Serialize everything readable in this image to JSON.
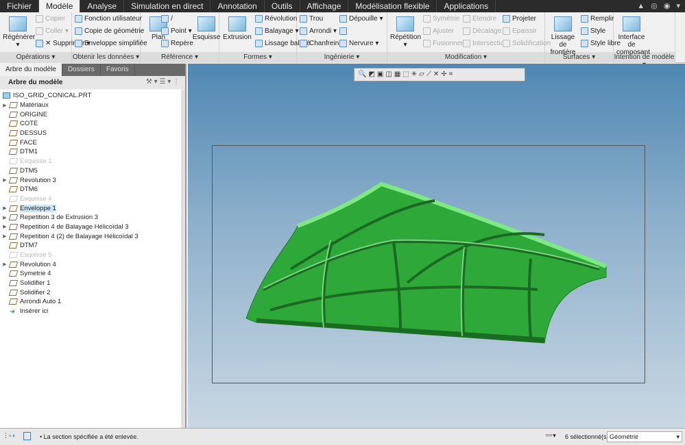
{
  "tabs": [
    "Fichier",
    "Modèle",
    "Analyse",
    "Simulation en direct",
    "Annotation",
    "Outils",
    "Affichage",
    "Modélisation flexible",
    "Applications"
  ],
  "active_tab": "Modèle",
  "groups": [
    {
      "label": "Opérations ▾",
      "items": [
        {
          "t": "Copier",
          "d": true
        },
        {
          "t": "Coller ▾",
          "d": true
        },
        {
          "t": "✕ Supprimer ▾"
        }
      ],
      "big": [
        "Régénérer ▾"
      ]
    },
    {
      "label": "Obtenir les données ▾",
      "items": [
        {
          "t": "Fonction utilisateur"
        },
        {
          "t": "Copie de géométrie"
        },
        {
          "t": "Enveloppe simplifiée"
        }
      ],
      "big": []
    },
    {
      "label": "Référence ▾",
      "items": [
        {
          "t": "/"
        },
        {
          "t": "Point ▾"
        },
        {
          "t": "Repère"
        }
      ],
      "big": [
        "Plan",
        "Esquisse"
      ]
    },
    {
      "label": "Formes ▾",
      "items": [
        {
          "t": "Révolution"
        },
        {
          "t": "Balayage ▾"
        },
        {
          "t": "Lissage balayé"
        }
      ],
      "big": [
        "Extrusion"
      ]
    },
    {
      "label": "Ingénierie ▾",
      "items": [
        {
          "t": "Trou"
        },
        {
          "t": "Arrondi ▾"
        },
        {
          "t": "Chanfrein ▾"
        },
        {
          "t": "Dépouille ▾"
        },
        {
          "t": ""
        },
        {
          "t": "Nervure ▾"
        }
      ],
      "big": []
    },
    {
      "label": "Modification ▾",
      "items": [
        {
          "t": "Symétrie",
          "d": true
        },
        {
          "t": "Ajuster",
          "d": true
        },
        {
          "t": "Fusionner",
          "d": true
        },
        {
          "t": "Etendre",
          "d": true
        },
        {
          "t": "Décalage",
          "d": true
        },
        {
          "t": "Intersection",
          "d": true
        },
        {
          "t": "Projeter"
        },
        {
          "t": "Epaissir",
          "d": true
        },
        {
          "t": "Solidification",
          "d": true
        }
      ],
      "big": [
        "Répétition ▾"
      ]
    },
    {
      "label": "Surfaces ▾",
      "items": [
        {
          "t": "Remplir"
        },
        {
          "t": "Style"
        },
        {
          "t": "Style libre"
        }
      ],
      "big": [
        "Lissage de frontière"
      ]
    },
    {
      "label": "Intention de modèle ▾",
      "items": [],
      "big": [
        "Interface de composant"
      ]
    }
  ],
  "left_tabs": [
    "Arbre du modèle",
    "Dossiers",
    "Favoris"
  ],
  "tree_header": "Arbre du modèle",
  "tree": [
    {
      "t": "ISO_GRID_CONICAL.PRT",
      "root": true
    },
    {
      "t": "Matériaux",
      "exp": true
    },
    {
      "t": "ORIGINE"
    },
    {
      "t": "COTE"
    },
    {
      "t": "DESSUS"
    },
    {
      "t": "FACE"
    },
    {
      "t": "DTM1"
    },
    {
      "t": "Esquisse 1",
      "dim": true
    },
    {
      "t": "DTM5"
    },
    {
      "t": "Revolution 3",
      "exp": true
    },
    {
      "t": "DTM6"
    },
    {
      "t": "Esquisse 4",
      "dim": true
    },
    {
      "t": "Enveloppe 1",
      "exp": true,
      "sel": true
    },
    {
      "t": "Repetition 3 de Extrusion 3",
      "exp": true
    },
    {
      "t": "Repetition 4 de Balayage Hélicoïdal 3",
      "exp": true
    },
    {
      "t": "Repetition 4 (2) de Balayage Hélicoïdal 3",
      "exp": true
    },
    {
      "t": "DTM7"
    },
    {
      "t": "Esquisse 5",
      "dim": true
    },
    {
      "t": "Revolution 4",
      "exp": true
    },
    {
      "t": "Symetrie 4"
    },
    {
      "t": "Solidifier 1"
    },
    {
      "t": "Solidifier 2"
    },
    {
      "t": "Arrondi Auto 1"
    },
    {
      "t": "Insérer ici",
      "insert": true
    }
  ],
  "status": {
    "message": "• La section spécifiée a été enlevée.",
    "selected": "6 sélectionné(s)",
    "filter": "Géométrie"
  },
  "colors": {
    "model": "#2fa83a",
    "accent": "#4f87b2"
  }
}
